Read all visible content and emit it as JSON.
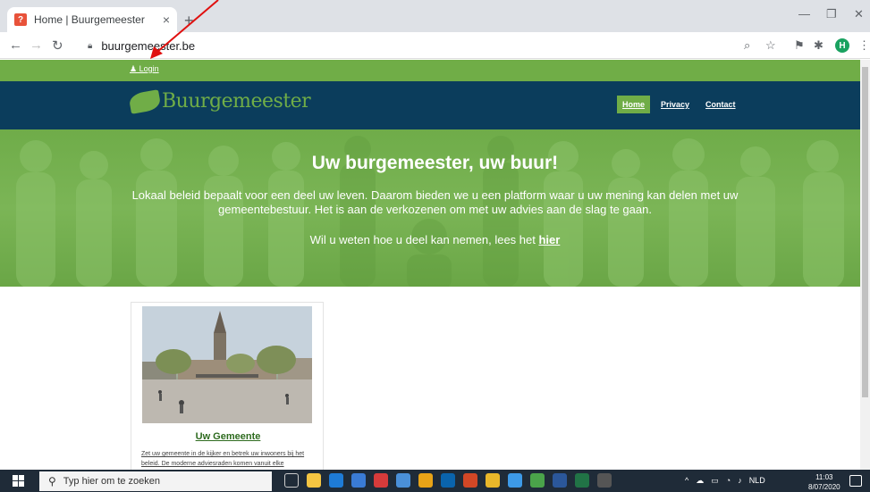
{
  "browser": {
    "tab_title": "Home | Buurgemeester",
    "tab_close": "×",
    "new_tab": "+",
    "url": "buurgemeester.be",
    "favicon_glyph": "?",
    "profile_initial": "H",
    "window_minimize": "—",
    "window_restore": "❐",
    "window_close": "✕"
  },
  "site": {
    "login_label": "Login",
    "logo_text": "Buurgemeester",
    "menu": [
      {
        "label": "Home",
        "active": true
      },
      {
        "label": "Privacy",
        "active": false
      },
      {
        "label": "Contact",
        "active": false
      }
    ],
    "hero": {
      "title": "Uw burgemeester, uw buur!",
      "text": "Lokaal beleid bepaalt voor een deel uw leven. Daarom bieden we u een platform waar u uw mening kan delen met uw gemeentebestuur. Het is aan de verkozenen om met uw advies aan de slag te gaan.",
      "cta_prefix": "Wil u weten hoe u deel kan nemen, lees het ",
      "cta_link": "hier"
    },
    "card": {
      "title": "Uw Gemeente",
      "text": "Zet uw gemeente in de kijker en betrek uw inwoners bij het beleid. De moderne adviesraden komen vanuit elke"
    },
    "colors": {
      "green": "#70ad47",
      "navy": "#0b3d5c"
    }
  },
  "taskbar": {
    "search_placeholder": "Typ hier om te zoeken",
    "language": "NLD",
    "time": "11:03",
    "date": "8/07/2020"
  }
}
